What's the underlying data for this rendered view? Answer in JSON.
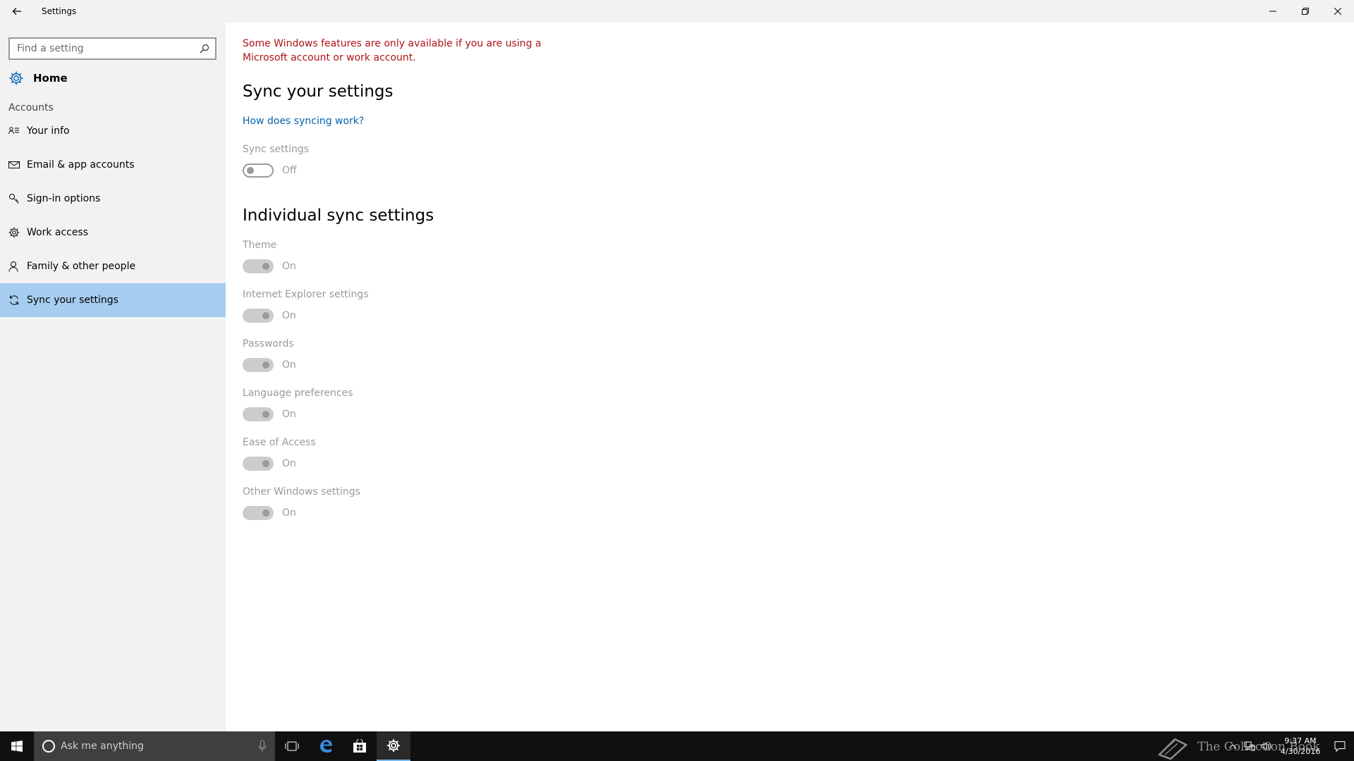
{
  "window": {
    "title": "Settings"
  },
  "sidebar": {
    "search_placeholder": "Find a setting",
    "home_label": "Home",
    "section_label": "Accounts",
    "items": [
      {
        "label": "Your info",
        "icon": "contact-info-icon"
      },
      {
        "label": "Email & app accounts",
        "icon": "mail-icon"
      },
      {
        "label": "Sign-in options",
        "icon": "key-icon"
      },
      {
        "label": "Work access",
        "icon": "gear-icon"
      },
      {
        "label": "Family & other people",
        "icon": "person-icon"
      },
      {
        "label": "Sync your settings",
        "icon": "sync-icon",
        "active": true
      }
    ]
  },
  "main": {
    "warning": "Some Windows features are only available if you are using a Microsoft account or work account.",
    "heading": "Sync your settings",
    "link": "How does syncing work?",
    "sync_setting": {
      "label": "Sync settings",
      "state": "Off"
    },
    "individual_heading": "Individual sync settings",
    "individual": [
      {
        "label": "Theme",
        "state": "On"
      },
      {
        "label": "Internet Explorer settings",
        "state": "On"
      },
      {
        "label": "Passwords",
        "state": "On"
      },
      {
        "label": "Language preferences",
        "state": "On"
      },
      {
        "label": "Ease of Access",
        "state": "On"
      },
      {
        "label": "Other Windows settings",
        "state": "On"
      }
    ]
  },
  "taskbar": {
    "search_text": "Ask me anything",
    "time": "9:37 AM",
    "date": "4/30/2016"
  },
  "watermark": {
    "text": "The Collection Book"
  },
  "colors": {
    "accent": "#a6cdf0",
    "warning": "#b01318",
    "link": "#0063b1"
  }
}
